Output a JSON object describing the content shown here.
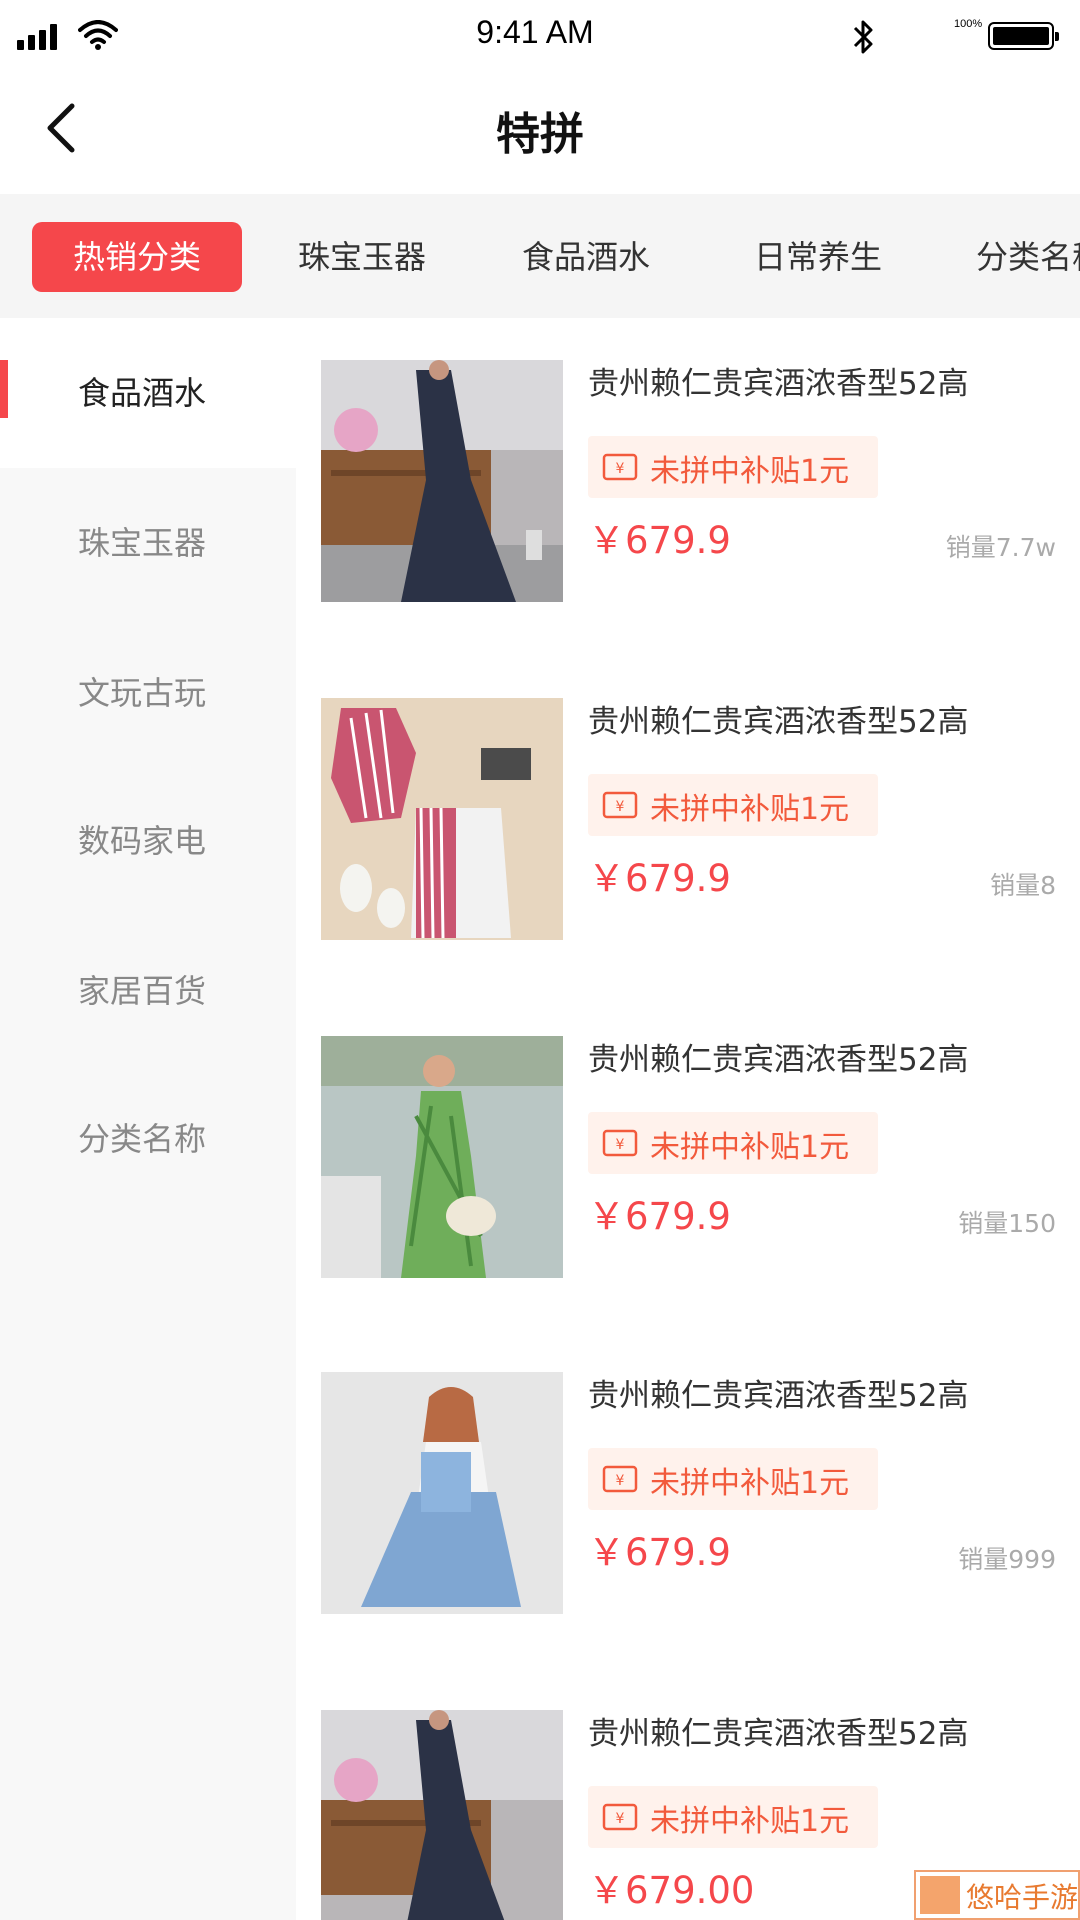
{
  "status_bar": {
    "time": "9:41 AM",
    "battery_percent": "100%"
  },
  "nav": {
    "title": "特拼"
  },
  "tabs": [
    {
      "label": "热销分类",
      "active": true
    },
    {
      "label": "珠宝玉器",
      "active": false
    },
    {
      "label": "食品酒水",
      "active": false
    },
    {
      "label": "日常养生",
      "active": false
    },
    {
      "label": "分类名称",
      "active": false
    }
  ],
  "sidebar": {
    "items": [
      {
        "label": "食品酒水",
        "active": true
      },
      {
        "label": "珠宝玉器",
        "active": false
      },
      {
        "label": "文玩古玩",
        "active": false
      },
      {
        "label": "数码家电",
        "active": false
      },
      {
        "label": "家居百货",
        "active": false
      },
      {
        "label": "分类名称",
        "active": false
      }
    ]
  },
  "products": [
    {
      "name": "贵州赖仁贵宾酒浓香型52高",
      "coupon": "未拼中补贴1元",
      "price": "￥679.9",
      "sales": "销量7.7w"
    },
    {
      "name": "贵州赖仁贵宾酒浓香型52高",
      "coupon": "未拼中补贴1元",
      "price": "￥679.9",
      "sales": "销量8"
    },
    {
      "name": "贵州赖仁贵宾酒浓香型52高",
      "coupon": "未拼中补贴1元",
      "price": "￥679.9",
      "sales": "销量150"
    },
    {
      "name": "贵州赖仁贵宾酒浓香型52高",
      "coupon": "未拼中补贴1元",
      "price": "￥679.9",
      "sales": "销量999"
    },
    {
      "name": "贵州赖仁贵宾酒浓香型52高",
      "coupon": "未拼中补贴1元",
      "price": "￥679.00",
      "sales": ""
    }
  ],
  "watermark": {
    "text": "悠哈手游"
  },
  "colors": {
    "accent": "#f5474b",
    "coupon_bg": "#fff2ec",
    "coupon_text": "#f25a3c",
    "sidebar_bg": "#f8f8f8",
    "tab_bar_bg": "#f5f5f5"
  }
}
